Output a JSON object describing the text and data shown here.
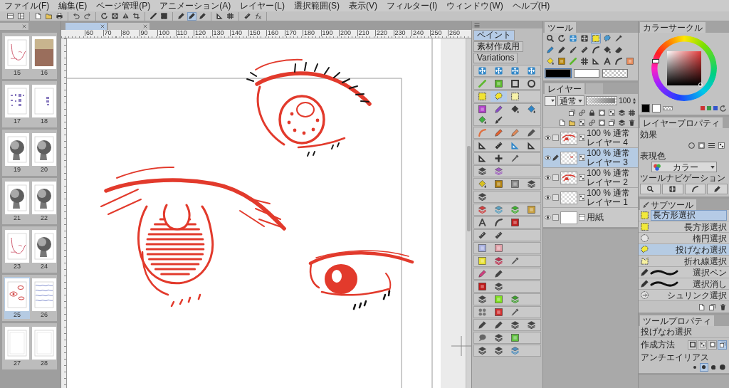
{
  "menu_bar": {
    "items": [
      "ファイル(F)",
      "編集(E)",
      "ページ管理(P)",
      "アニメーション(A)",
      "レイヤー(L)",
      "選択範囲(S)",
      "表示(V)",
      "フィルター(I)",
      "ウィンドウ(W)",
      "ヘルプ(H)"
    ]
  },
  "toolbar": {
    "groups": [
      [
        {
          "kind": "window",
          "selected": false
        },
        {
          "kind": "panel",
          "selected": false
        }
      ],
      [
        {
          "kind": "doc",
          "selected": false
        },
        {
          "kind": "folder",
          "selected": false
        },
        {
          "kind": "printer",
          "selected": false
        }
      ],
      [
        {
          "kind": "undo",
          "selected": false
        },
        {
          "kind": "redo",
          "selected": false
        }
      ],
      [
        {
          "kind": "rotate",
          "selected": false
        },
        {
          "kind": "move",
          "selected": false
        },
        {
          "kind": "flip",
          "selected": false
        },
        {
          "kind": "crop",
          "selected": false
        }
      ],
      [
        {
          "kind": "line",
          "selected": false
        },
        {
          "kind": "dotted-rect",
          "selected": false
        }
      ],
      [
        {
          "kind": "pen",
          "selected": false
        },
        {
          "kind": "pen",
          "selected": true
        },
        {
          "kind": "pen",
          "selected": false
        }
      ],
      [
        {
          "kind": "frame",
          "selected": false
        },
        {
          "kind": "grid",
          "selected": false
        }
      ],
      [
        {
          "kind": "ruler",
          "selected": false
        },
        {
          "kind": "fx",
          "selected": false
        }
      ]
    ]
  },
  "page_manager": {
    "spreads": [
      {
        "pages": [
          {
            "number": "15",
            "kind": "sketch",
            "selected": false
          },
          {
            "number": "16",
            "kind": "portrait",
            "selected": false
          }
        ]
      },
      {
        "pages": [
          {
            "number": "17",
            "kind": "notes",
            "selected": false
          },
          {
            "number": "18",
            "kind": "notes-small",
            "selected": false
          }
        ]
      },
      {
        "pages": [
          {
            "number": "19",
            "kind": "head",
            "selected": false
          },
          {
            "number": "20",
            "kind": "head",
            "selected": false
          }
        ]
      },
      {
        "pages": [
          {
            "number": "21",
            "kind": "head",
            "selected": false
          },
          {
            "number": "22",
            "kind": "head",
            "selected": false
          }
        ]
      },
      {
        "pages": [
          {
            "number": "23",
            "kind": "sketch",
            "selected": false
          },
          {
            "number": "24",
            "kind": "head",
            "selected": false
          }
        ]
      },
      {
        "pages": [
          {
            "number": "25",
            "kind": "eyes",
            "selected": true
          },
          {
            "number": "26",
            "kind": "writing",
            "selected": false
          }
        ]
      },
      {
        "pages": [
          {
            "number": "27",
            "kind": "blank",
            "selected": false
          },
          {
            "number": "28",
            "kind": "blank",
            "selected": false
          }
        ]
      }
    ]
  },
  "canvas": {
    "tabs": [
      {
        "selected": true
      },
      {
        "selected": false
      }
    ],
    "ruler_labels": [
      "60",
      "70",
      "80",
      "90",
      "100",
      "110",
      "120",
      "130",
      "140",
      "150",
      "160",
      "170",
      "180",
      "190",
      "200",
      "210",
      "220",
      "230",
      "240",
      "250",
      "260"
    ]
  },
  "sub_tool_palette": {
    "tabs": [
      {
        "label": "ペイント",
        "selected": true
      },
      {
        "label": "素材作成用",
        "selected": false
      },
      {
        "label": "Variations",
        "selected": false
      }
    ],
    "groups": [
      [
        {
          "kind": "move",
          "color": "#2f86c8",
          "selected": false
        },
        {
          "kind": "move",
          "color": "#2f86c8",
          "selected": false
        },
        {
          "kind": "move",
          "color": "#2f86c8",
          "selected": false
        },
        {
          "kind": "move",
          "color": "#2f86c8",
          "selected": false
        }
      ],
      [
        {
          "kind": "line",
          "color": "#5cb82e",
          "selected": false
        },
        {
          "kind": "tile",
          "color": "#5cb82e",
          "selected": false
        },
        {
          "kind": "rect",
          "color": "#3a3a3a",
          "selected": false
        },
        {
          "kind": "ellipse",
          "color": "#3a3a3a",
          "selected": false
        }
      ],
      [
        {
          "kind": "dotted-rect",
          "color": "#f2e332",
          "selected": false
        },
        {
          "kind": "lasso",
          "color": "#f2e332",
          "selected": true
        },
        {
          "kind": "dotted-rect",
          "color": "#f7f2a8",
          "selected": false
        }
      ],
      [
        {
          "kind": "tile",
          "color": "#b040c8",
          "selected": false
        },
        {
          "kind": "pen",
          "color": "#8a50c8",
          "selected": false
        },
        {
          "kind": "bucket",
          "color": "#3a3a3a",
          "selected": false
        },
        {
          "kind": "bucket",
          "color": "#2f86c8",
          "selected": false
        },
        {
          "kind": "bucket",
          "color": "#40b040",
          "selected": false
        },
        {
          "kind": "brush",
          "color": "#3a3a3a",
          "selected": false
        }
      ],
      [
        {
          "kind": "curve",
          "color": "#e07040",
          "selected": false
        },
        {
          "kind": "pen",
          "color": "#e06030",
          "selected": false
        },
        {
          "kind": "pen",
          "color": "#e08a5a",
          "selected": false
        },
        {
          "kind": "pen",
          "color": "#555555",
          "selected": false
        }
      ],
      [
        {
          "kind": "frame",
          "color": "#333333",
          "selected": false
        },
        {
          "kind": "ruler",
          "color": "#333333",
          "selected": false
        },
        {
          "kind": "frame",
          "color": "#2f86c8",
          "selected": false
        },
        {
          "kind": "frame",
          "color": "#333333",
          "selected": false
        }
      ],
      [
        {
          "kind": "frame",
          "color": "#333333",
          "selected": false
        },
        {
          "kind": "cross",
          "color": "#333333",
          "selected": false
        },
        {
          "kind": "eyedropper",
          "color": "#555555",
          "selected": false
        }
      ],
      [
        {
          "kind": "layer",
          "color": "#444444",
          "selected": false
        },
        {
          "kind": "layer",
          "color": "#a060c0",
          "selected": false
        }
      ],
      [
        {
          "kind": "bucket",
          "color": "#d8c020",
          "selected": false
        },
        {
          "kind": "tile",
          "color": "#b08010",
          "selected": false
        },
        {
          "kind": "tile",
          "color": "#888888",
          "selected": false
        },
        {
          "kind": "layer",
          "color": "#444444",
          "selected": false
        }
      ],
      [
        {
          "kind": "layer",
          "color": "#444444",
          "selected": false
        }
      ],
      [
        {
          "kind": "layer",
          "color": "#d04040",
          "selected": false
        },
        {
          "kind": "layer",
          "color": "#5aa0c0",
          "selected": false
        },
        {
          "kind": "layer",
          "color": "#40b030",
          "selected": false
        },
        {
          "kind": "tile",
          "color": "#c8a040",
          "selected": false
        }
      ],
      [
        {
          "kind": "text",
          "color": "#444444",
          "selected": false
        },
        {
          "kind": "curve",
          "color": "#444444",
          "selected": false
        },
        {
          "kind": "tile",
          "color": "#c02020",
          "selected": false
        }
      ],
      [
        {
          "kind": "ruler",
          "color": "#444444",
          "selected": false
        },
        {
          "kind": "ruler",
          "color": "#444444",
          "selected": false
        }
      ],
      [
        {
          "kind": "tile",
          "color": "#a8b0e0",
          "selected": false
        },
        {
          "kind": "tile",
          "color": "#e0a0a8",
          "selected": false
        }
      ],
      [
        {
          "kind": "tile",
          "color": "#e8e030",
          "selected": false
        },
        {
          "kind": "layer",
          "color": "#c03050",
          "selected": false
        },
        {
          "kind": "eyedropper",
          "color": "#555555",
          "selected": false
        }
      ],
      [
        {
          "kind": "pen",
          "color": "#d04080",
          "selected": false
        },
        {
          "kind": "pen",
          "color": "#444444",
          "selected": false
        }
      ],
      [
        {
          "kind": "tile",
          "color": "#c01818",
          "selected": false
        },
        {
          "kind": "layer",
          "color": "#444444",
          "selected": false
        }
      ],
      [
        {
          "kind": "layer",
          "color": "#444444",
          "selected": false
        },
        {
          "kind": "tile",
          "color": "#80e020",
          "selected": false
        },
        {
          "kind": "layer",
          "color": "#40a030",
          "selected": false
        }
      ],
      [
        {
          "kind": "dots",
          "color": "#777777",
          "selected": false
        },
        {
          "kind": "tile",
          "color": "#d03030",
          "selected": false
        },
        {
          "kind": "eyedropper",
          "color": "#555555",
          "selected": false
        }
      ],
      [
        {
          "kind": "pen",
          "color": "#444444",
          "selected": false
        },
        {
          "kind": "pen",
          "color": "#444444",
          "selected": false
        },
        {
          "kind": "layer",
          "color": "#444444",
          "selected": false
        },
        {
          "kind": "layer",
          "color": "#444444",
          "selected": false
        }
      ],
      [
        {
          "kind": "balloon",
          "color": "#666666",
          "selected": false
        },
        {
          "kind": "layer",
          "color": "#444444",
          "selected": false
        },
        {
          "kind": "tile",
          "color": "#60c040",
          "selected": false
        }
      ],
      [
        {
          "kind": "layer",
          "color": "#444444",
          "selected": false
        },
        {
          "kind": "layer",
          "color": "#444444",
          "selected": false
        },
        {
          "kind": "layer",
          "color": "#5090c0",
          "selected": false
        }
      ]
    ]
  },
  "tool_panel": {
    "title": "ツール",
    "rows": [
      [
        {
          "kind": "magnifier",
          "color": "#3a3a3a",
          "selected": false
        },
        {
          "kind": "rotate",
          "color": "#3a3a3a",
          "selected": false
        },
        {
          "kind": "move",
          "color": "#2f86c8",
          "selected": false
        },
        {
          "kind": "move",
          "color": "#3a3a3a",
          "selected": false
        },
        {
          "kind": "dotted-rect",
          "color": "#f2e332",
          "selected": true
        },
        {
          "kind": "lasso",
          "color": "#4a9ad0",
          "selected": false
        },
        {
          "kind": "eyedropper",
          "color": "#3a3a3a",
          "selected": false
        }
      ],
      [
        {
          "kind": "pen",
          "color": "#2f86c8",
          "selected": false
        },
        {
          "kind": "pen",
          "color": "#3a3a3a",
          "selected": false
        },
        {
          "kind": "brush",
          "color": "#3a3a3a",
          "selected": false
        },
        {
          "kind": "ruler",
          "color": "#3a3a3a",
          "selected": false
        },
        {
          "kind": "curve",
          "color": "#3a3a3a",
          "selected": false
        },
        {
          "kind": "bucket",
          "color": "#3a3a3a",
          "selected": false
        },
        {
          "kind": "eraser",
          "color": "#3a3a3a",
          "selected": false
        }
      ],
      [
        {
          "kind": "bucket",
          "color": "#f2d92a",
          "selected": false
        },
        {
          "kind": "tile",
          "color": "#b8860b",
          "selected": false
        },
        {
          "kind": "line",
          "color": "#5cb82e",
          "selected": false
        },
        {
          "kind": "grid",
          "color": "#3a3a3a",
          "selected": false
        },
        {
          "kind": "frame",
          "color": "#3a3a3a",
          "selected": false
        },
        {
          "kind": "text",
          "color": "#3a3a3a",
          "selected": false
        },
        {
          "kind": "curve",
          "color": "#3a3a3a",
          "selected": false
        },
        {
          "kind": "tile",
          "color": "#e58a5a",
          "selected": false
        }
      ]
    ],
    "colors": [
      {
        "kind": "main",
        "color": "#000000",
        "selected": true
      },
      {
        "kind": "sub",
        "color": "#ffffff",
        "selected": false
      },
      {
        "kind": "transparent",
        "selected": false
      }
    ]
  },
  "layer_panel": {
    "tabs": [
      {
        "label": "レイヤー",
        "selected": true
      },
      {
        "selected": false
      }
    ],
    "blend_mode": "通常",
    "opacity": {
      "level": 1,
      "value": "100"
    },
    "layers": [
      {
        "mode": "100 % 通常",
        "name": "レイヤー 4",
        "kind": "raster",
        "thumbnail": {
          "kind": "eyes"
        },
        "visible": true,
        "editing": false,
        "selected": false
      },
      {
        "mode": "100 % 通常",
        "name": "レイヤー 3",
        "kind": "raster",
        "thumbnail": {
          "kind": "dot"
        },
        "visible": true,
        "editing": true,
        "selected": true
      },
      {
        "mode": "100 % 通常",
        "name": "レイヤー 2",
        "kind": "raster",
        "thumbnail": {
          "kind": "eyes"
        },
        "visible": true,
        "editing": false,
        "selected": false
      },
      {
        "mode": "100 % 通常",
        "name": "レイヤー 1",
        "kind": "raster",
        "thumbnail": {
          "kind": "empty"
        },
        "visible": true,
        "editing": false,
        "selected": false
      },
      {
        "name": "用紙",
        "kind": "paper",
        "thumbnail": {
          "kind": "paper"
        },
        "visible": true,
        "editing": false,
        "selected": false
      }
    ]
  },
  "color_circle": {
    "title": "カラーサークル",
    "swatches": [
      {
        "color": "#000000"
      },
      {
        "color": "#ffffff"
      }
    ],
    "color_dots": [
      {
        "color": "#cc3333"
      },
      {
        "color": "#3a9a4a"
      },
      {
        "color": "#3355cc"
      }
    ]
  },
  "layer_property": {
    "title": "レイヤープロパティ",
    "effect_label": "効果",
    "color_label": "表現色",
    "color_mode": "カラー",
    "nav_label": "ツールナビゲーション"
  },
  "sub_tool": {
    "title": "サブツール",
    "items": [
      {
        "label": "長方形選択",
        "kind": "dotted-rect",
        "selected": false,
        "editing": true
      },
      {
        "label": "長方形選択",
        "kind": "dotted-rect",
        "selected": false,
        "editing": false
      },
      {
        "label": "楕円選択",
        "kind": "dotted-circle",
        "selected": false,
        "editing": false
      },
      {
        "label": "投げなわ選択",
        "kind": "lasso",
        "selected": true,
        "editing": false
      },
      {
        "label": "折れ線選択",
        "kind": "polyline",
        "selected": false,
        "editing": false
      },
      {
        "label": "選択ペン",
        "kind": "stroke",
        "selected": false,
        "editing": false
      },
      {
        "label": "選択消し",
        "kind": "stroke",
        "selected": false,
        "editing": false
      },
      {
        "label": "シュリンク選択",
        "kind": "shrink",
        "selected": false,
        "editing": false
      }
    ]
  },
  "tool_property": {
    "title": "ツールプロパティ",
    "tool_name": "投げなわ選択",
    "rows": [
      {
        "label": "作成方法",
        "kind": "buttons",
        "options": [
          {
            "selected": false
          },
          {
            "selected": false
          },
          {
            "selected": false
          },
          {
            "selected": true
          }
        ]
      },
      {
        "label": "アンチエイリアス",
        "kind": "dots",
        "options": [
          {
            "selected": false
          },
          {
            "selected": true
          },
          {
            "selected": false
          },
          {
            "selected": false
          }
        ]
      }
    ]
  }
}
